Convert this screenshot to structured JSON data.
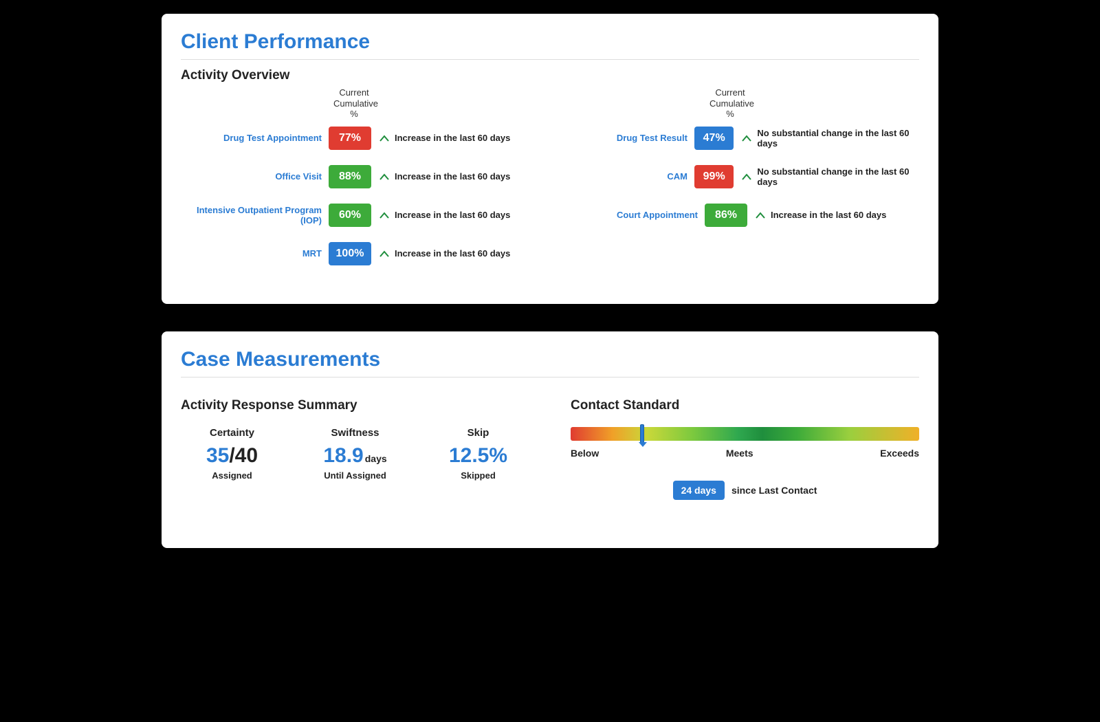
{
  "performance": {
    "title": "Client Performance",
    "section": "Activity Overview",
    "col_header_l1": "Current",
    "col_header_l2": "Cumulative %",
    "left": [
      {
        "label": "Drug Test Appointment",
        "value": "77%",
        "color": "red",
        "trend": "Increase in the last 60 days"
      },
      {
        "label": "Office Visit",
        "value": "88%",
        "color": "green",
        "trend": "Increase in the last 60 days"
      },
      {
        "label": "Intensive Outpatient Program (IOP)",
        "value": "60%",
        "color": "green",
        "trend": "Increase in the last 60 days"
      },
      {
        "label": "MRT",
        "value": "100%",
        "color": "blue",
        "trend": "Increase in the last 60 days"
      }
    ],
    "right": [
      {
        "label": "Drug Test Result",
        "value": "47%",
        "color": "blue",
        "trend": "No substantial change in the last 60 days"
      },
      {
        "label": "CAM",
        "value": "99%",
        "color": "red",
        "trend": "No substantial change in the last 60 days"
      },
      {
        "label": "Court Appointment",
        "value": "86%",
        "color": "green",
        "trend": "Increase in the last 60 days"
      }
    ]
  },
  "measurements": {
    "title": "Case Measurements",
    "summary_heading": "Activity Response Summary",
    "contact_heading": "Contact Standard",
    "certainty": {
      "label": "Certainty",
      "num": "35",
      "sep": "/",
      "den": "40",
      "sub": "Assigned"
    },
    "swiftness": {
      "label": "Swiftness",
      "value": "18.9",
      "unit": "days",
      "sub": "Until Assigned"
    },
    "skip": {
      "label": "Skip",
      "value": "12.5%",
      "sub": "Skipped"
    },
    "scale": {
      "below": "Below",
      "meets": "Meets",
      "exceeds": "Exceeds",
      "marker_percent": 20
    },
    "contact": {
      "badge": "24 days",
      "text": "since Last Contact"
    }
  }
}
